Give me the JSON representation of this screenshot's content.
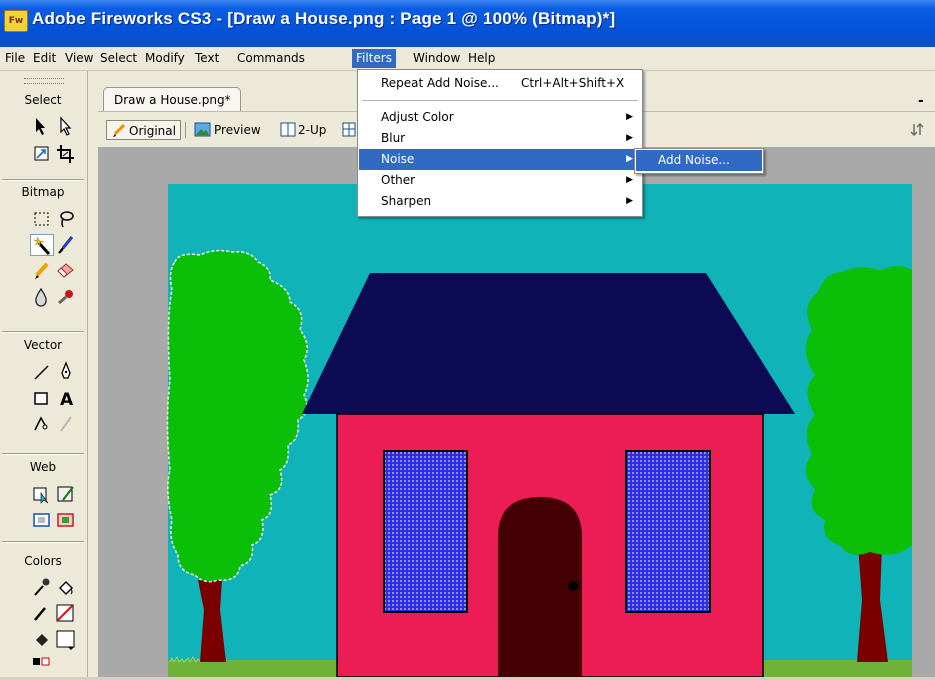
{
  "window": {
    "app_badge": "Fw",
    "title": "Adobe Fireworks CS3 - [Draw a House.png : Page 1 @ 100% (Bitmap)*]"
  },
  "menubar": {
    "items": [
      "File",
      "Edit",
      "View",
      "Select",
      "Modify",
      "Text",
      "Commands",
      "Filters",
      "Window",
      "Help"
    ],
    "active": "Filters"
  },
  "tools": {
    "sections": {
      "select": "Select",
      "bitmap": "Bitmap",
      "vector": "Vector",
      "web": "Web",
      "colors": "Colors"
    },
    "selected_tool": "magic-wand"
  },
  "document": {
    "tab_label": "Draw a House.png*",
    "minimize_label": "-",
    "view_buttons": {
      "original": "Original",
      "preview": "Preview",
      "two_up": "2-Up"
    }
  },
  "filters_menu": {
    "repeat": {
      "label": "Repeat Add Noise...",
      "shortcut": "Ctrl+Alt+Shift+X"
    },
    "items": [
      {
        "label": "Adjust Color",
        "submenu": true,
        "highlighted": false
      },
      {
        "label": "Blur",
        "submenu": true,
        "highlighted": false
      },
      {
        "label": "Noise",
        "submenu": true,
        "highlighted": true
      },
      {
        "label": "Other",
        "submenu": true,
        "highlighted": false
      },
      {
        "label": "Sharpen",
        "submenu": true,
        "highlighted": false
      }
    ],
    "submenu_arrow": "▶"
  },
  "noise_submenu": {
    "items": [
      {
        "label": "Add Noise...",
        "highlighted": true
      }
    ]
  },
  "colors": {
    "titlebar": "#0553d8",
    "menu_highlight": "#316ac5",
    "sky": "#0fb3b8",
    "roof": "#0b0a52",
    "wall": "#ec1d55",
    "window": "#2d2de6",
    "door": "#450006",
    "tree_foliage": "#0bbf09",
    "trunk": "#7a0000",
    "grass": "#6fb23a"
  }
}
